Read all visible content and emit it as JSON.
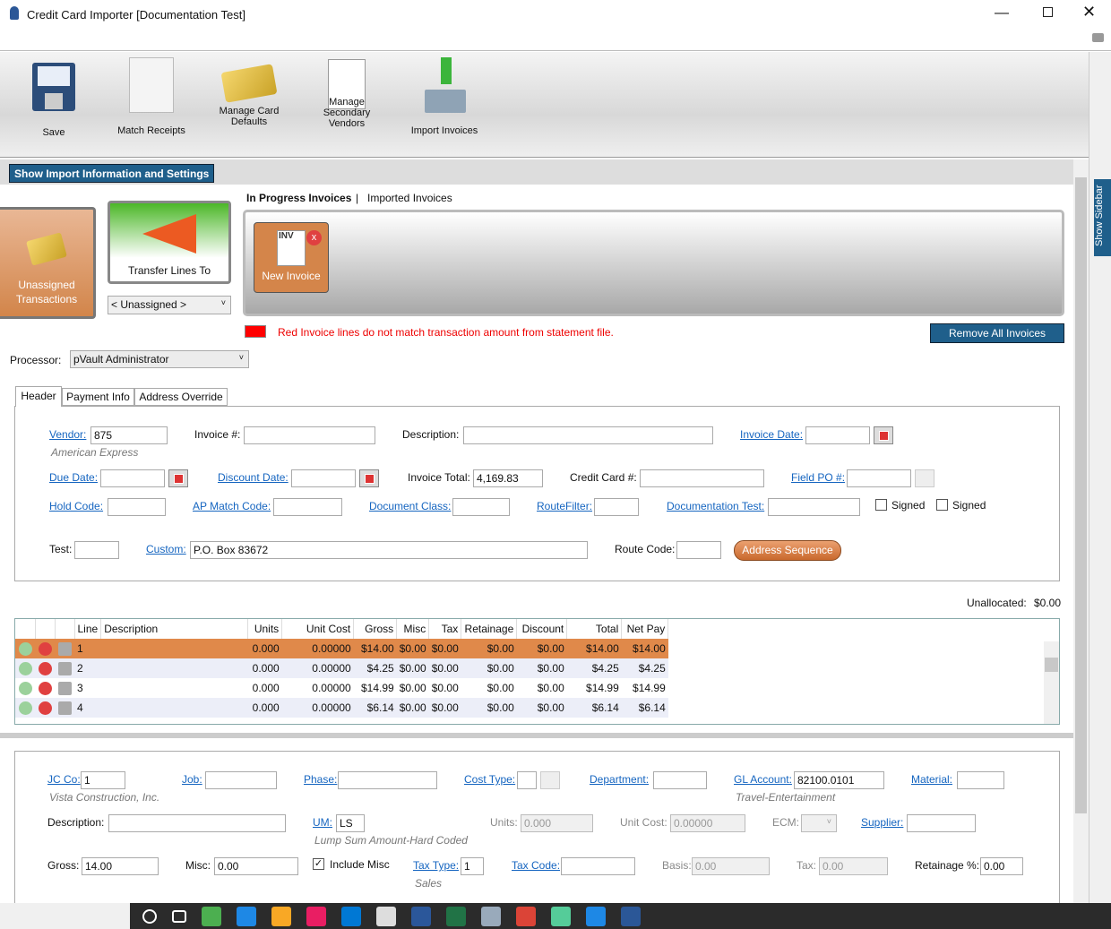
{
  "window": {
    "title": "Credit Card Importer [Documentation Test]",
    "icon": "lock-icon"
  },
  "toolbar": [
    {
      "label": "Save",
      "icon": "floppy-disk-icon"
    },
    {
      "label": "Match Receipts",
      "icon": "receipt-magnifier-icon"
    },
    {
      "label": "Manage Card Defaults",
      "icon": "credit-card-gear-icon"
    },
    {
      "label": "Manage Secondary Vendors",
      "icon": "sales-quotation-icon"
    },
    {
      "label": "Import Invoices",
      "icon": "import-tray-icon"
    }
  ],
  "show_import_label": "Show Import Information and Settings",
  "show_sidebar_label": "Show Sidebar",
  "unassigned_label": "Unassigned Transactions",
  "transfer_label": "Transfer Lines To",
  "transfer_select": "< Unassigned >",
  "invoice_tabs": {
    "active": "In Progress Invoices",
    "separator": "|",
    "other": "Imported Invoices"
  },
  "new_invoice_label": "New Invoice",
  "inv_badge": "INV",
  "legend_text": "Red Invoice lines do not match transaction amount from statement file.",
  "legend_color": "#ff0000",
  "remove_all_label": "Remove All Invoices",
  "processor": {
    "label": "Processor:",
    "value": "pVault Administrator"
  },
  "tabs": [
    "Header",
    "Payment Info",
    "Address Override"
  ],
  "header": {
    "vendor": {
      "label": "Vendor:",
      "value": "875",
      "sub": "American Express"
    },
    "invoice_no": {
      "label": "Invoice #:",
      "value": ""
    },
    "description": {
      "label": "Description:",
      "value": ""
    },
    "invoice_date": {
      "label": "Invoice Date:",
      "value": ""
    },
    "due_date": {
      "label": "Due Date:",
      "value": ""
    },
    "discount_date": {
      "label": "Discount Date:",
      "value": ""
    },
    "invoice_total": {
      "label": "Invoice Total:",
      "value": "4,169.83"
    },
    "credit_card": {
      "label": "Credit Card #:",
      "value": ""
    },
    "field_po": {
      "label": "Field PO #:",
      "value": ""
    },
    "hold_code": {
      "label": "Hold Code:",
      "value": ""
    },
    "ap_match": {
      "label": "AP Match Code:",
      "value": ""
    },
    "doc_class": {
      "label": "Document Class:",
      "value": ""
    },
    "route_filter": {
      "label": "RouteFilter:",
      "value": ""
    },
    "doc_test": {
      "label": "Documentation Test:",
      "value": ""
    },
    "signed1": "Signed",
    "signed2": "Signed",
    "test": {
      "label": "Test:",
      "value": ""
    },
    "custom": {
      "label": "Custom:",
      "value": "P.O. Box 83672"
    },
    "route_code": {
      "label": "Route Code:",
      "value": ""
    },
    "address_seq": "Address Sequence"
  },
  "unallocated": {
    "label": "Unallocated:",
    "value": "$0.00"
  },
  "grid": {
    "columns": [
      "Line",
      "Description",
      "Units",
      "Unit Cost",
      "Gross",
      "Misc",
      "Tax",
      "Retainage",
      "Discount",
      "Total",
      "Net Pay"
    ],
    "rows": [
      [
        "1",
        "",
        "0.000",
        "0.00000",
        "$14.00",
        "$0.00",
        "$0.00",
        "$0.00",
        "$0.00",
        "$14.00",
        "$14.00"
      ],
      [
        "2",
        "",
        "0.000",
        "0.00000",
        "$4.25",
        "$0.00",
        "$0.00",
        "$0.00",
        "$0.00",
        "$4.25",
        "$4.25"
      ],
      [
        "3",
        "",
        "0.000",
        "0.00000",
        "$14.99",
        "$0.00",
        "$0.00",
        "$0.00",
        "$0.00",
        "$14.99",
        "$14.99"
      ],
      [
        "4",
        "",
        "0.000",
        "0.00000",
        "$6.14",
        "$0.00",
        "$0.00",
        "$0.00",
        "$0.00",
        "$6.14",
        "$6.14"
      ]
    ],
    "selected_color": "#e0894a"
  },
  "line": {
    "jcco": {
      "label": "JC Co:",
      "value": "1",
      "sub": "Vista Construction, Inc."
    },
    "job": {
      "label": "Job:",
      "value": ""
    },
    "phase": {
      "label": "Phase:",
      "value": ""
    },
    "cost_type": {
      "label": "Cost Type:",
      "value": ""
    },
    "department": {
      "label": "Department:",
      "value": ""
    },
    "gl": {
      "label": "GL Account:",
      "value": "82100.0101",
      "sub": "Travel-Entertainment"
    },
    "material": {
      "label": "Material:",
      "value": ""
    },
    "description": {
      "label": "Description:",
      "value": ""
    },
    "um": {
      "label": "UM:",
      "value": "LS",
      "sub": "Lump Sum Amount-Hard Coded"
    },
    "units": {
      "label": "Units:",
      "value": "0.000"
    },
    "unit_cost": {
      "label": "Unit Cost:",
      "value": "0.00000"
    },
    "ecm": {
      "label": "ECM:",
      "value": ""
    },
    "supplier": {
      "label": "Supplier:",
      "value": ""
    },
    "gross": {
      "label": "Gross:",
      "value": "14.00"
    },
    "misc": {
      "label": "Misc:",
      "value": "0.00"
    },
    "include_misc": "Include Misc",
    "tax_type": {
      "label": "Tax Type:",
      "value": "1",
      "sub": "Sales"
    },
    "tax_code": {
      "label": "Tax Code:",
      "value": ""
    },
    "basis": {
      "label": "Basis:",
      "value": "0.00"
    },
    "tax": {
      "label": "Tax:",
      "value": "0.00"
    },
    "retainage": {
      "label": "Retainage %:",
      "value": "0.00"
    }
  },
  "taskbar": [
    "cortana-icon",
    "task-view-icon",
    "app-icon",
    "edge-icon",
    "file-explorer-icon",
    "slack-icon",
    "outlook-icon",
    "app-icon",
    "word-icon",
    "excel-icon",
    "app-icon",
    "chrome-icon",
    "app-icon",
    "help-icon",
    "lock-icon"
  ]
}
